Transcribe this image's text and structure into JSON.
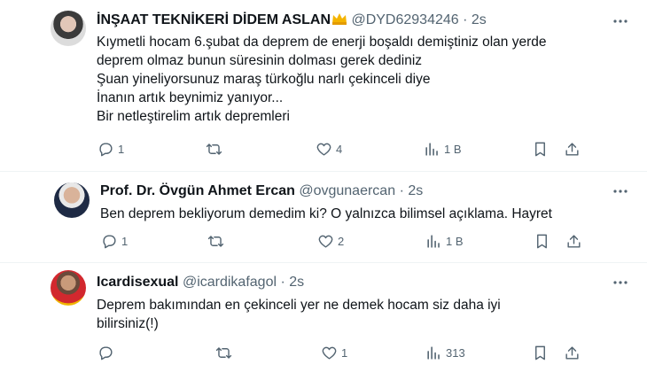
{
  "tweets": [
    {
      "display_name": "İNŞAAT TEKNİKERİ DİDEM ASLAN",
      "handle": "@DYD62934246",
      "separator": "·",
      "time": "2s",
      "lines": [
        "Kıymetli hocam 6.şubat da deprem de enerji boşaldı  demiştiniz olan yerde",
        "deprem olmaz bunun süresinin dolması gerek dediniz",
        "Şuan yineliyorsunuz maraş türkoğlu  narlı çekinceli  diye",
        "İnanın artık  beynimiz yanıyor...",
        "Bir netleştirelim  artık depremleri"
      ],
      "replies": "1",
      "retweets": "",
      "likes": "4",
      "views": "1 B"
    },
    {
      "display_name": "Prof. Dr. Övgün Ahmet Ercan",
      "handle": "@ovgunaercan",
      "separator": "·",
      "time": "2s",
      "lines": [
        "Ben deprem bekliyorum demedim ki? O yalnızca bilimsel açıklama. Hayret"
      ],
      "replies": "1",
      "retweets": "",
      "likes": "2",
      "views": "1 B"
    },
    {
      "display_name": "Icardisexual",
      "handle": "@icardikafagol",
      "separator": "·",
      "time": "2s",
      "lines": [
        "Deprem bakımından en çekinceli yer ne demek hocam siz daha iyi",
        "bilirsiniz(!)"
      ],
      "replies": "",
      "retweets": "",
      "likes": "1",
      "views": "313"
    }
  ],
  "colors": {
    "text": "#0f1419",
    "muted": "#536471",
    "divider": "#eff3f4"
  },
  "icons": [
    "more-icon",
    "reply-icon",
    "retweet-icon",
    "like-icon",
    "views-icon",
    "bookmark-icon",
    "share-icon"
  ]
}
